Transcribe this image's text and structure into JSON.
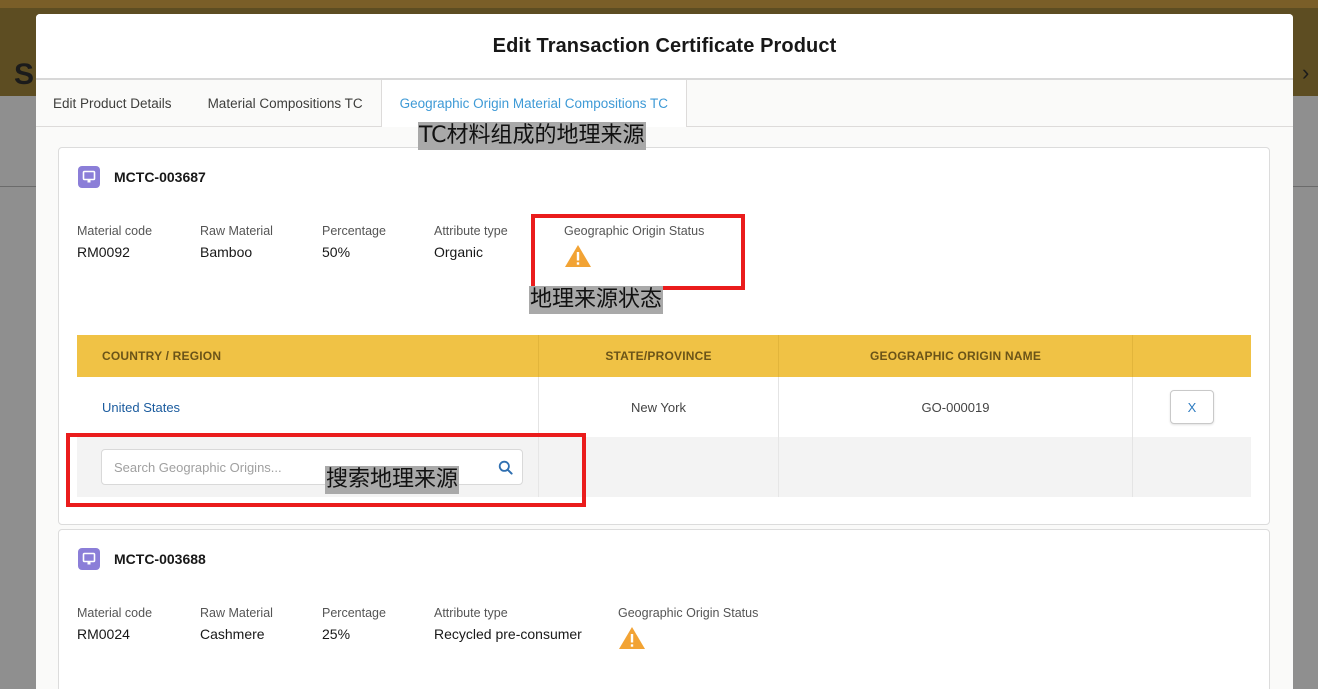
{
  "modal": {
    "title": "Edit Transaction Certificate Product",
    "tabs": [
      {
        "label": "Edit Product Details",
        "active": false
      },
      {
        "label": "Material Compositions TC",
        "active": false
      },
      {
        "label": "Geographic Origin Material Compositions TC",
        "active": true
      }
    ]
  },
  "cards": [
    {
      "code": "MCTC-003687",
      "fields": [
        {
          "label": "Material code",
          "value": "RM0092"
        },
        {
          "label": "Raw Material",
          "value": "Bamboo"
        },
        {
          "label": "Percentage",
          "value": "50%"
        },
        {
          "label": "Attribute type",
          "value": "Organic"
        },
        {
          "label": "Geographic Origin Status",
          "status_icon": "warning-icon"
        }
      ],
      "table": {
        "headers": [
          "COUNTRY / REGION",
          "STATE/PROVINCE",
          "GEOGRAPHIC ORIGIN NAME"
        ],
        "rows": [
          {
            "country": "United States",
            "state": "New York",
            "origin_name": "GO-000019",
            "delete_label": "X"
          }
        ],
        "search_placeholder": "Search Geographic Origins..."
      }
    },
    {
      "code": "MCTC-003688",
      "fields": [
        {
          "label": "Material code",
          "value": "RM0024"
        },
        {
          "label": "Raw Material",
          "value": "Cashmere"
        },
        {
          "label": "Percentage",
          "value": "25%"
        },
        {
          "label": "Attribute type",
          "value": "Recycled pre-consumer"
        },
        {
          "label": "Geographic Origin Status",
          "status_icon": "warning-icon"
        }
      ]
    }
  ],
  "annotations": {
    "tab_caption": "TC材料组成的地理来源",
    "status_caption": "地理来源状态",
    "search_caption": "搜索地理来源"
  },
  "colors": {
    "header_gold": "#f0c245",
    "link_blue": "#1a5b9e",
    "active_tab": "#3e9ad6",
    "warning": "#f2a334",
    "record_icon": "#8b7ed8",
    "annotation_red": "#ea1c1c"
  }
}
